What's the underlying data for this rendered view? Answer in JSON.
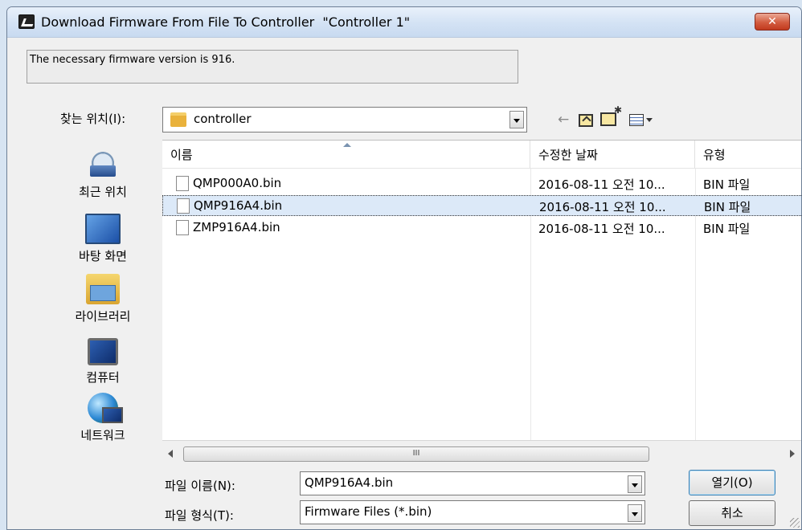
{
  "window": {
    "title": "Download Firmware From File To Controller  \"Controller 1\"",
    "close_label": "✕"
  },
  "info": {
    "message": "The necessary firmware version is 916."
  },
  "lookin": {
    "label": "찾는 위치(I):",
    "value": "controller"
  },
  "places": [
    {
      "label": "최근 위치",
      "icon": "recent-places-icon"
    },
    {
      "label": "바탕 화면",
      "icon": "desktop-icon"
    },
    {
      "label": "라이브러리",
      "icon": "library-icon"
    },
    {
      "label": "컴퓨터",
      "icon": "computer-icon"
    },
    {
      "label": "네트워크",
      "icon": "network-icon"
    }
  ],
  "columns": {
    "name": "이름",
    "date": "수정한 날짜",
    "type": "유형"
  },
  "files": [
    {
      "name": "QMP000A0.bin",
      "date": "2016-08-11 오전 10...",
      "type": "BIN 파일",
      "selected": false
    },
    {
      "name": "QMP916A4.bin",
      "date": "2016-08-11 오전 10...",
      "type": "BIN 파일",
      "selected": true
    },
    {
      "name": "ZMP916A4.bin",
      "date": "2016-08-11 오전 10...",
      "type": "BIN 파일",
      "selected": false
    }
  ],
  "scroll": {
    "thumb_label": "III"
  },
  "filename": {
    "label": "파일 이름(N):",
    "value": "QMP916A4.bin"
  },
  "filetype": {
    "label": "파일 형식(T):",
    "value": "Firmware Files (*.bin)"
  },
  "buttons": {
    "open": "열기(O)",
    "cancel": "취소"
  },
  "toolbar": {
    "back_glyph": "←"
  }
}
